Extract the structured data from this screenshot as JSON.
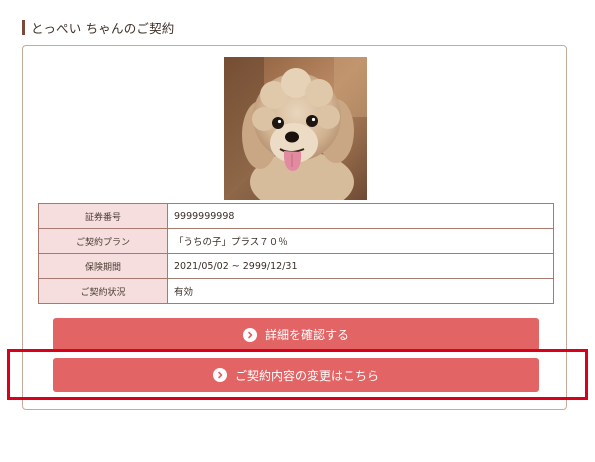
{
  "header": {
    "title": "とっぺい ちゃんのご契約"
  },
  "contract": {
    "rows": [
      {
        "label": "証券番号",
        "value": "9999999998"
      },
      {
        "label": "ご契約プラン",
        "value": "「うちの子」プラス７０％"
      },
      {
        "label": "保険期間",
        "value": "2021/05/02 ~ 2999/12/31"
      },
      {
        "label": "ご契約状況",
        "value": "有効"
      }
    ]
  },
  "buttons": {
    "detail_label": "詳細を確認する",
    "change_label": "ご契約内容の変更はこちら"
  },
  "icons": {
    "chevron": "chevron-right-circle-icon"
  },
  "colors": {
    "accent": "#e26464",
    "label_bg": "#f6dede",
    "highlight": "#d8001a",
    "border": "#a77a70"
  }
}
